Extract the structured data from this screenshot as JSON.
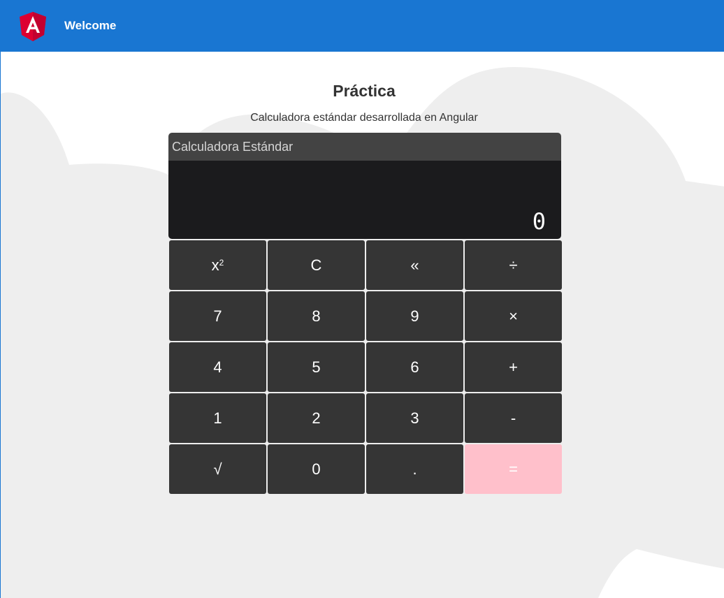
{
  "toolbar": {
    "title": "Welcome"
  },
  "main": {
    "heading": "Práctica",
    "subtitle": "Calculadora estándar desarrollada en Angular"
  },
  "calculator": {
    "header": "Calculadora Estándar",
    "display_value": "0",
    "keys": [
      {
        "label": "x",
        "superscript": "2",
        "name": "square-button"
      },
      {
        "label": "C",
        "name": "clear-button"
      },
      {
        "label": "«",
        "name": "backspace-button"
      },
      {
        "label": "÷",
        "name": "divide-button"
      },
      {
        "label": "7",
        "name": "digit-7-button"
      },
      {
        "label": "8",
        "name": "digit-8-button"
      },
      {
        "label": "9",
        "name": "digit-9-button"
      },
      {
        "label": "×",
        "name": "multiply-button"
      },
      {
        "label": "4",
        "name": "digit-4-button"
      },
      {
        "label": "5",
        "name": "digit-5-button"
      },
      {
        "label": "6",
        "name": "digit-6-button"
      },
      {
        "label": "+",
        "name": "add-button"
      },
      {
        "label": "1",
        "name": "digit-1-button"
      },
      {
        "label": "2",
        "name": "digit-2-button"
      },
      {
        "label": "3",
        "name": "digit-3-button"
      },
      {
        "label": "-",
        "name": "subtract-button"
      },
      {
        "label": "√",
        "name": "square-root-button"
      },
      {
        "label": "0",
        "name": "digit-0-button"
      },
      {
        "label": ".",
        "name": "decimal-button"
      },
      {
        "label": "=",
        "name": "equals-button"
      }
    ]
  },
  "colors": {
    "toolbar": "#1976d2",
    "calculator_header": "#434343",
    "display": "#1b1b1d",
    "key": "#353535",
    "equals_key": "#ffc0cb",
    "cloud": "#eeeeee"
  },
  "icons": {
    "logo": "angular-logo-icon"
  }
}
